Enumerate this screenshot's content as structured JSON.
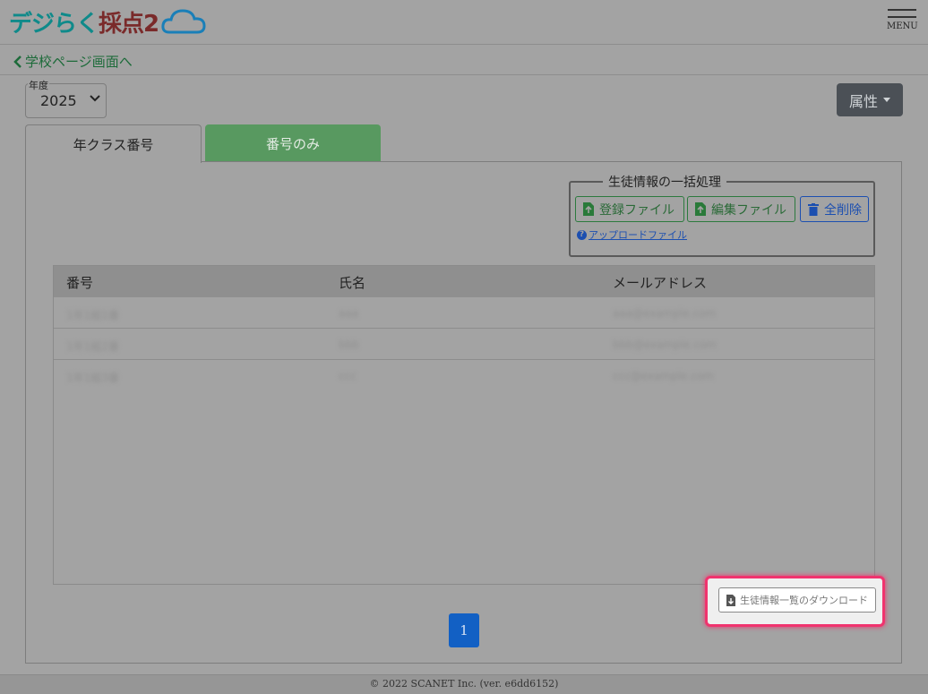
{
  "header": {
    "logo_part1": "デジらく",
    "logo_part2": "採点2",
    "menu_label": "MENU"
  },
  "nav": {
    "back_label": "学校ページ画面へ"
  },
  "year": {
    "legend": "年度",
    "value": "2025"
  },
  "attributes": {
    "label": "属性"
  },
  "tabs": [
    {
      "label": "年クラス番号",
      "active": true
    },
    {
      "label": "番号のみ",
      "active": false
    }
  ],
  "bulk": {
    "title": "生徒情報の一括処理",
    "register_label": "登録ファイル",
    "edit_label": "編集ファイル",
    "delete_label": "全削除",
    "upload_link": "アップロードファイル"
  },
  "table": {
    "headers": [
      "番号",
      "氏名",
      "メールアドレス"
    ],
    "rows": [
      [
        "1年1組1番",
        "aaa",
        "aaa@example.com"
      ],
      [
        "1年1組2番",
        "bbb",
        "bbb@example.com"
      ],
      [
        "1年1組3番",
        "ccc",
        "ccc@example.com"
      ]
    ]
  },
  "download": {
    "label": "生徒情報一覧のダウンロード"
  },
  "pagination": {
    "current": "1"
  },
  "footer": {
    "text": "© 2022 SCANET Inc. (ver. e6dd6152)"
  },
  "colors": {
    "accent_green": "#589960",
    "primary_blue": "#1260c4",
    "highlight_pink": "#f0336e"
  }
}
